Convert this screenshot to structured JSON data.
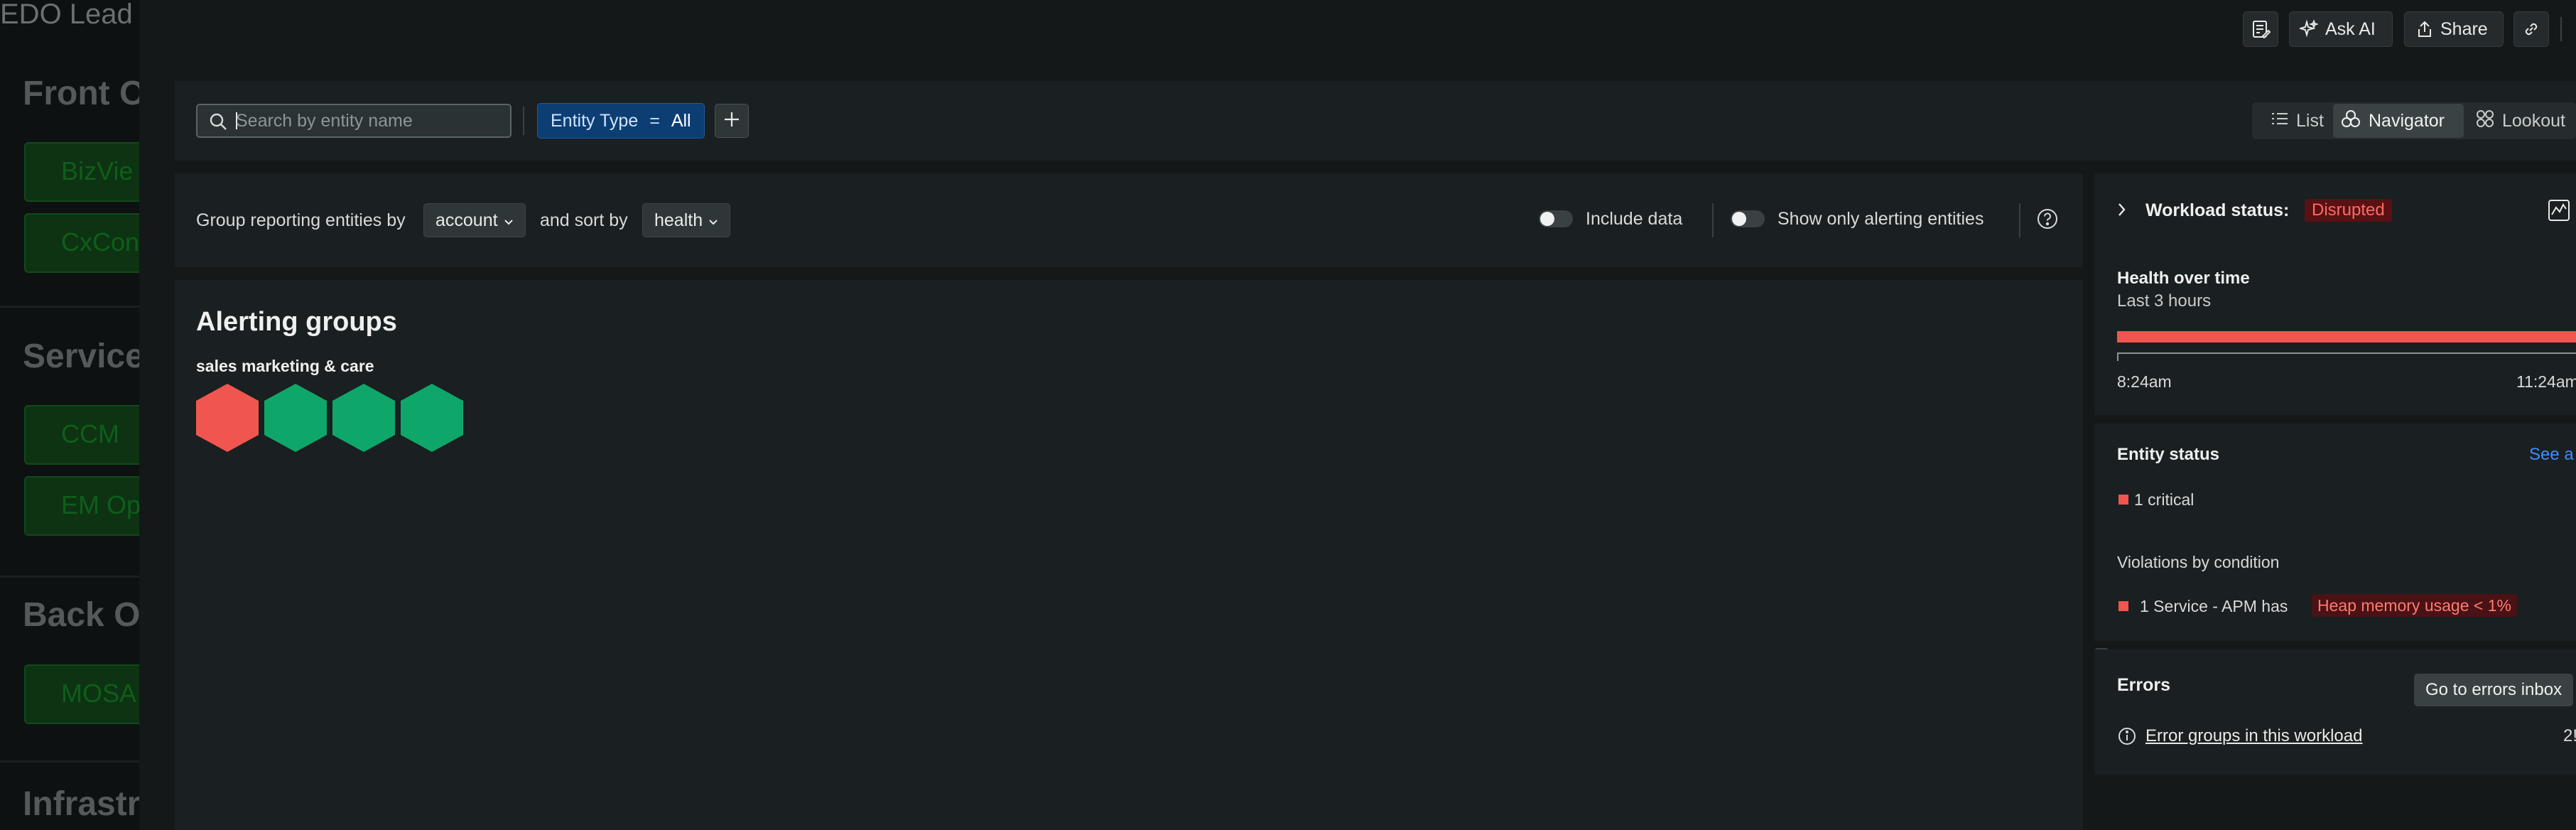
{
  "background": {
    "title": "EDO Lead",
    "sections": [
      {
        "title": "Front O",
        "tiles": [
          "BizVie",
          "CxCon"
        ]
      },
      {
        "title": "Service",
        "tiles": [
          "CCM",
          "EM Op"
        ]
      },
      {
        "title": "Back Of",
        "tiles": [
          "MOSA"
        ]
      },
      {
        "title": "Infrastr",
        "tiles": []
      }
    ]
  },
  "toolbar": {
    "notes_icon": "notes-icon",
    "ask_ai": "Ask AI",
    "share": "Share",
    "link_icon": "link-icon"
  },
  "filter": {
    "search_placeholder": "Search by entity name",
    "search_value": "",
    "pill_key": "Entity Type",
    "pill_op": "=",
    "pill_value": "All",
    "add_icon": "plus-icon"
  },
  "views": {
    "list": "List",
    "navigator": "Navigator",
    "lookout": "Lookout",
    "active": "Navigator"
  },
  "grouping": {
    "group_label": "Group reporting entities by",
    "group_value": "account",
    "sort_label": "and sort by",
    "sort_value": "health",
    "include_data": "Include data",
    "show_alerting": "Show only alerting entities"
  },
  "alerting": {
    "title": "Alerting groups",
    "group_name": "sales marketing & care",
    "hexagons": [
      "critical",
      "healthy",
      "healthy",
      "healthy"
    ]
  },
  "workload": {
    "status_label": "Workload status:",
    "status_value": "Disrupted",
    "health_title": "Health over time",
    "health_sub": "Last 3 hours",
    "time_start": "8:24am",
    "time_end": "11:24am"
  },
  "entity_status": {
    "title": "Entity status",
    "see_all": "See a",
    "critical": "1 critical",
    "violations_title": "Violations by condition",
    "violation_text": "1 Service - APM has",
    "violation_badge": "Heap memory usage < 1%"
  },
  "errors": {
    "title": "Errors",
    "button": "Go to errors inbox",
    "link": "Error groups in this workload",
    "count": "2!"
  },
  "colors": {
    "critical": "#f0564f",
    "healthy": "#0fa66a",
    "accent_blue": "#0c3e73",
    "disrupted_bg": "#5a1113",
    "disrupted_text": "#ff6b63",
    "link_blue": "#3d8eff"
  }
}
